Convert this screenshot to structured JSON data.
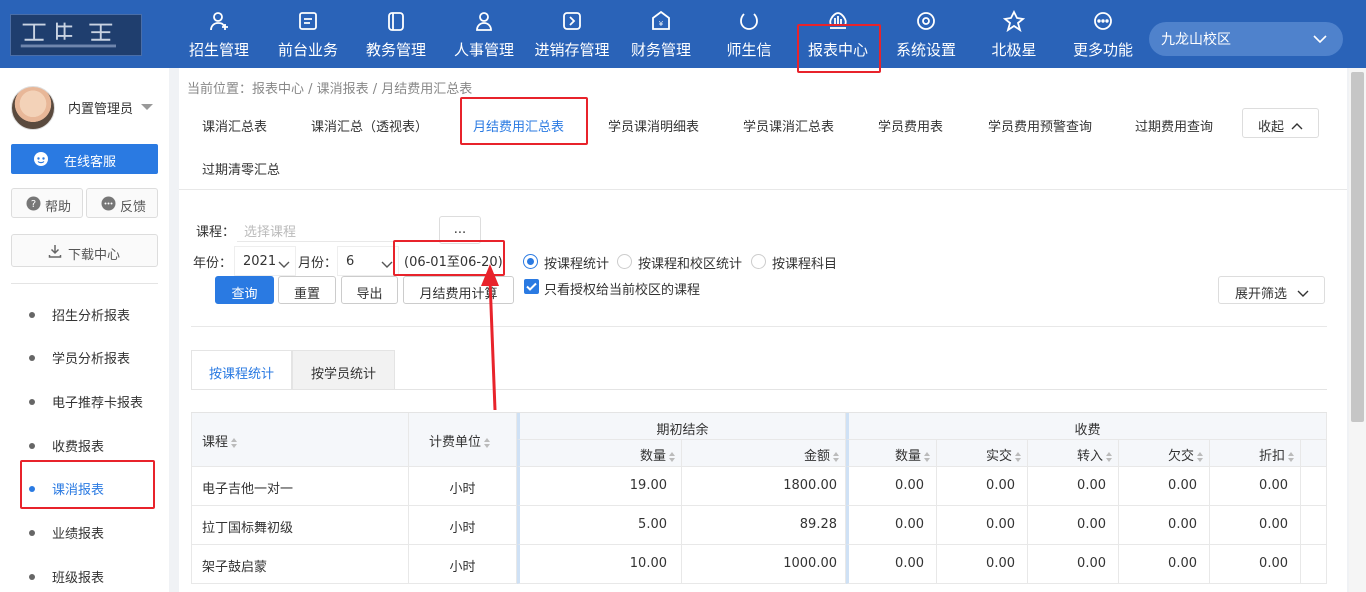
{
  "topnav": {
    "items": [
      {
        "label": "招生管理",
        "icon": "user-add-icon"
      },
      {
        "label": "前台业务",
        "icon": "desk-icon"
      },
      {
        "label": "教务管理",
        "icon": "book-icon"
      },
      {
        "label": "人事管理",
        "icon": "person-icon"
      },
      {
        "label": "进销存管理",
        "icon": "inventory-icon"
      },
      {
        "label": "财务管理",
        "icon": "finance-icon"
      },
      {
        "label": "师生信",
        "icon": "chat-icon"
      },
      {
        "label": "报表中心",
        "icon": "report-icon"
      },
      {
        "label": "系统设置",
        "icon": "settings-icon"
      },
      {
        "label": "北极星",
        "icon": "star-icon"
      },
      {
        "label": "更多功能",
        "icon": "more-icon"
      }
    ],
    "campus": "九龙山校区"
  },
  "sidebar": {
    "username": "内置管理员",
    "service": "在线客服",
    "help": "帮助",
    "feedback": "反馈",
    "download": "下载中心",
    "menu": [
      {
        "label": "招生分析报表"
      },
      {
        "label": "学员分析报表"
      },
      {
        "label": "电子推荐卡报表"
      },
      {
        "label": "收费报表"
      },
      {
        "label": "课消报表"
      },
      {
        "label": "业绩报表"
      },
      {
        "label": "班级报表"
      }
    ]
  },
  "main": {
    "breadcrumb": "当前位置：报表中心 / 课消报表 / 月结费用汇总表",
    "tabs": [
      "课消汇总表",
      "课消汇总（透视表）",
      "月结费用汇总表",
      "学员课消明细表",
      "学员课消汇总表",
      "学员费用表",
      "学员费用预警查询",
      "过期费用查询",
      "过期清零汇总"
    ],
    "collapse": "收起",
    "filters": {
      "course_label": "课程：",
      "course_placeholder": "选择课程",
      "dots": "...",
      "year_label": "年份：",
      "year_value": "2021",
      "month_label": "月份：",
      "month_value": "6",
      "range": "(06-01至06-20)",
      "radios": [
        "按课程统计",
        "按课程和校区统计",
        "按课程科目"
      ],
      "buttons": {
        "query": "查询",
        "reset": "重置",
        "export": "导出",
        "calc": "月结费用计算"
      },
      "checkbox_label": "只看授权给当前校区的课程",
      "expand": "展开筛选"
    },
    "subtabs": [
      "按课程统计",
      "按学员统计"
    ],
    "table": {
      "group_headers": {
        "opening": "期初结余",
        "charge": "收费"
      },
      "headers": {
        "course": "课程",
        "unit": "计费单位",
        "qty": "数量",
        "amount": "金额",
        "qty2": "数量",
        "paid": "实交",
        "transfer_in": "转入",
        "owed": "欠交",
        "discount": "折扣"
      },
      "rows": [
        {
          "course": "电子吉他一对一",
          "unit": "小时",
          "qty": "19.00",
          "amount": "1800.00",
          "qty2": "0.00",
          "paid": "0.00",
          "transfer_in": "0.00",
          "owed": "0.00",
          "discount": "0.00"
        },
        {
          "course": "拉丁国标舞初级",
          "unit": "小时",
          "qty": "5.00",
          "amount": "89.28",
          "qty2": "0.00",
          "paid": "0.00",
          "transfer_in": "0.00",
          "owed": "0.00",
          "discount": "0.00"
        },
        {
          "course": "架子鼓启蒙",
          "unit": "小时",
          "qty": "10.00",
          "amount": "1000.00",
          "qty2": "0.00",
          "paid": "0.00",
          "transfer_in": "0.00",
          "owed": "0.00",
          "discount": "0.00"
        }
      ]
    }
  },
  "colors": {
    "nav": "#2a63b8",
    "accent": "#2a7ae2",
    "highlight": "#e8232b"
  }
}
